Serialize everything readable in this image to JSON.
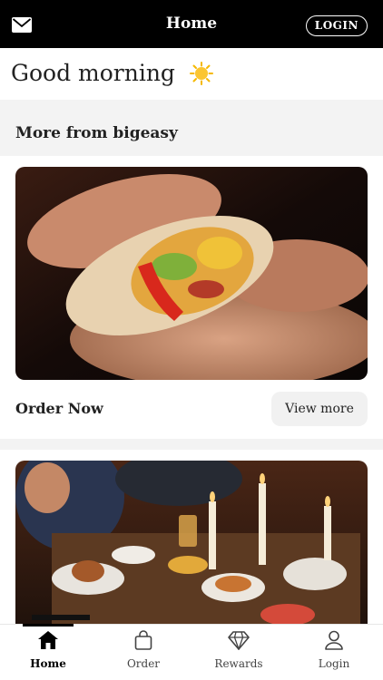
{
  "header": {
    "title": "Home",
    "login_label": "LOGIN",
    "left_icon": "mail-icon"
  },
  "greeting": {
    "text": "Good morning",
    "icon": "sun-icon",
    "icon_color": "#f5b800"
  },
  "section": {
    "title": "More from bigeasy"
  },
  "cards": [
    {
      "image": "burrito-photo",
      "action_label": "Order Now",
      "button_label": "View more"
    },
    {
      "image": "restaurant-table-photo"
    }
  ],
  "tabbar": {
    "items": [
      {
        "label": "Home",
        "icon": "home-icon",
        "active": true
      },
      {
        "label": "Order",
        "icon": "bag-icon",
        "active": false
      },
      {
        "label": "Rewards",
        "icon": "diamond-icon",
        "active": false
      },
      {
        "label": "Login",
        "icon": "user-icon",
        "active": false
      }
    ]
  },
  "colors": {
    "header_bg": "#000000",
    "section_bg": "#f3f3f3",
    "button_bg": "#f1f1f1"
  }
}
